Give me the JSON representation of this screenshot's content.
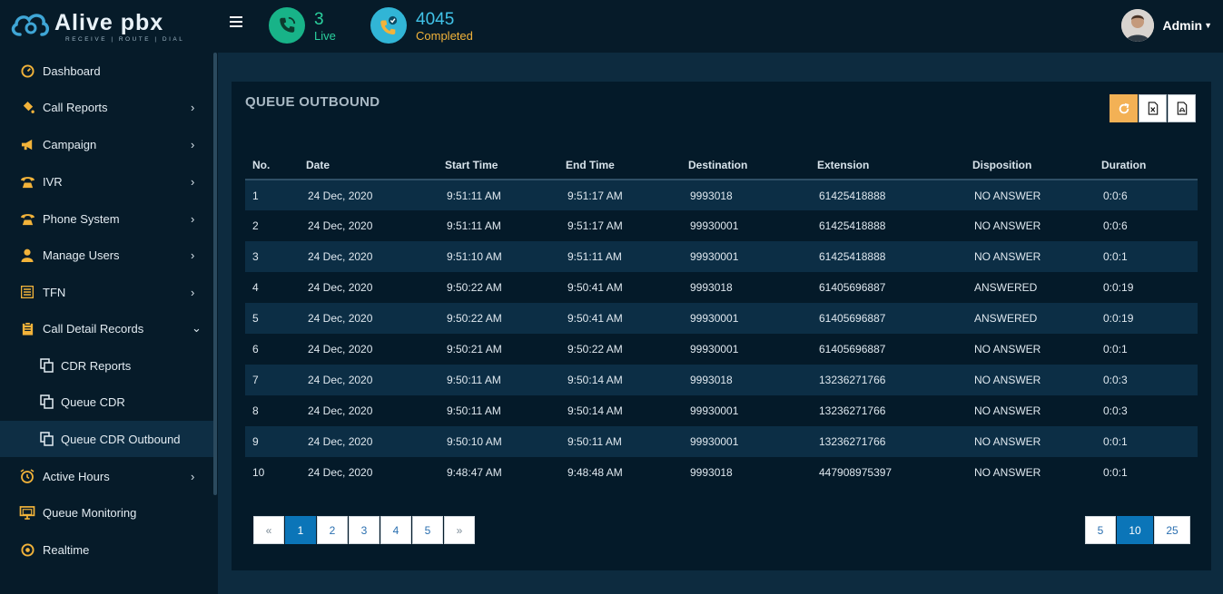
{
  "brand": {
    "name_part1": "Alive",
    "name_part2": "pbx",
    "tagline": "RECEIVE | ROUTE | DIAL"
  },
  "header": {
    "live": {
      "count": "3",
      "label": "Live"
    },
    "completed": {
      "count": "4045",
      "label": "Completed"
    },
    "user": {
      "name": "Admin"
    }
  },
  "sidebar": {
    "items": [
      {
        "label": "Dashboard",
        "icon": "dashboard-icon",
        "chevron": ""
      },
      {
        "label": "Call Reports",
        "icon": "paint-bucket-icon",
        "chevron": "›"
      },
      {
        "label": "Campaign",
        "icon": "megaphone-icon",
        "chevron": "›"
      },
      {
        "label": "IVR",
        "icon": "phone-icon",
        "chevron": "›"
      },
      {
        "label": "Phone System",
        "icon": "phone-icon",
        "chevron": "›"
      },
      {
        "label": "Manage Users",
        "icon": "user-icon",
        "chevron": "›"
      },
      {
        "label": "TFN",
        "icon": "list-icon",
        "chevron": "›"
      },
      {
        "label": "Call Detail Records",
        "icon": "clipboard-icon",
        "chevron": "⌄"
      },
      {
        "label": "CDR Reports",
        "icon": "copy-icon",
        "chevron": ""
      },
      {
        "label": "Queue CDR",
        "icon": "copy-icon",
        "chevron": ""
      },
      {
        "label": "Queue CDR Outbound",
        "icon": "copy-icon",
        "chevron": ""
      },
      {
        "label": "Active Hours",
        "icon": "alarm-clock-icon",
        "chevron": "›"
      },
      {
        "label": "Queue Monitoring",
        "icon": "monitor-icon",
        "chevron": ""
      },
      {
        "label": "Realtime",
        "icon": "realtime-icon",
        "chevron": ""
      }
    ]
  },
  "panel": {
    "title": "QUEUE OUTBOUND"
  },
  "table": {
    "headers": [
      "No.",
      "Date",
      "Start Time",
      "End Time",
      "Destination",
      "Extension",
      "Disposition",
      "Duration"
    ],
    "rows": [
      [
        "1",
        "24 Dec, 2020",
        "9:51:11 AM",
        "9:51:17 AM",
        "9993018",
        "61425418888",
        "NO ANSWER",
        "0:0:6"
      ],
      [
        "2",
        "24 Dec, 2020",
        "9:51:11 AM",
        "9:51:17 AM",
        "99930001",
        "61425418888",
        "NO ANSWER",
        "0:0:6"
      ],
      [
        "3",
        "24 Dec, 2020",
        "9:51:10 AM",
        "9:51:11 AM",
        "99930001",
        "61425418888",
        "NO ANSWER",
        "0:0:1"
      ],
      [
        "4",
        "24 Dec, 2020",
        "9:50:22 AM",
        "9:50:41 AM",
        "9993018",
        "61405696887",
        "ANSWERED",
        "0:0:19"
      ],
      [
        "5",
        "24 Dec, 2020",
        "9:50:22 AM",
        "9:50:41 AM",
        "99930001",
        "61405696887",
        "ANSWERED",
        "0:0:19"
      ],
      [
        "6",
        "24 Dec, 2020",
        "9:50:21 AM",
        "9:50:22 AM",
        "99930001",
        "61405696887",
        "NO ANSWER",
        "0:0:1"
      ],
      [
        "7",
        "24 Dec, 2020",
        "9:50:11 AM",
        "9:50:14 AM",
        "9993018",
        "13236271766",
        "NO ANSWER",
        "0:0:3"
      ],
      [
        "8",
        "24 Dec, 2020",
        "9:50:11 AM",
        "9:50:14 AM",
        "99930001",
        "13236271766",
        "NO ANSWER",
        "0:0:3"
      ],
      [
        "9",
        "24 Dec, 2020",
        "9:50:10 AM",
        "9:50:11 AM",
        "99930001",
        "13236271766",
        "NO ANSWER",
        "0:0:1"
      ],
      [
        "10",
        "24 Dec, 2020",
        "9:48:47 AM",
        "9:48:48 AM",
        "9993018",
        "447908975397",
        "NO ANSWER",
        "0:0:1"
      ]
    ]
  },
  "pagination": {
    "prev": "«",
    "next": "»",
    "pages": [
      "1",
      "2",
      "3",
      "4",
      "5"
    ],
    "active_page": "1",
    "page_sizes": [
      "5",
      "10",
      "25"
    ],
    "active_size": "10"
  },
  "colors": {
    "accent_orange": "#f3b155",
    "active_blue": "#0b75b8",
    "live_green": "#18b388",
    "completed_cyan": "#31b5d6"
  }
}
